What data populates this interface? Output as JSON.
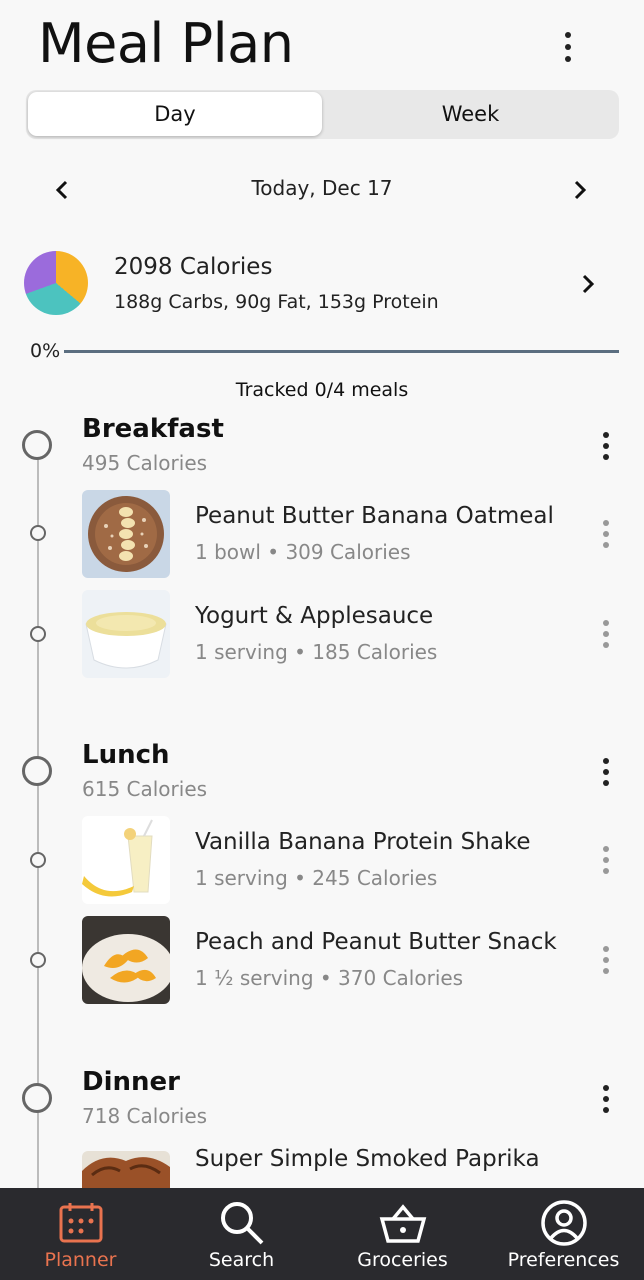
{
  "header": {
    "title": "Meal Plan"
  },
  "segmented": {
    "day": "Day",
    "week": "Week",
    "selected": "Day"
  },
  "date_nav": {
    "label": "Today, Dec 17"
  },
  "summary": {
    "calories": "2098 Calories",
    "macros": "188g Carbs, 90g Fat, 153g Protein",
    "pie_colors": {
      "carbs": "#f7b326",
      "fat": "#4cc3bf",
      "protein": "#9b6bdc"
    }
  },
  "progress": {
    "percent_label": "0%",
    "value": 0,
    "tracked": "Tracked 0/4 meals"
  },
  "meals": [
    {
      "title": "Breakfast",
      "calories": "495 Calories",
      "items": [
        {
          "name": "Peanut Butter Banana Oatmeal",
          "detail": "1 bowl • 309 Calories"
        },
        {
          "name": "Yogurt & Applesauce",
          "detail": "1 serving • 185 Calories"
        }
      ]
    },
    {
      "title": "Lunch",
      "calories": "615 Calories",
      "items": [
        {
          "name": "Vanilla Banana Protein Shake",
          "detail": "1 serving • 245 Calories"
        },
        {
          "name": "Peach and Peanut Butter Snack",
          "detail": "1 ½ serving • 370 Calories"
        }
      ]
    },
    {
      "title": "Dinner",
      "calories": "718 Calories",
      "items": [
        {
          "name": "Super Simple Smoked Paprika",
          "detail": ""
        }
      ]
    }
  ],
  "bottom_nav": {
    "active_color": "#e9734f",
    "items": [
      {
        "label": "Planner",
        "icon": "calendar-icon"
      },
      {
        "label": "Search",
        "icon": "search-icon"
      },
      {
        "label": "Groceries",
        "icon": "basket-icon"
      },
      {
        "label": "Preferences",
        "icon": "user-circle-icon"
      }
    ]
  }
}
